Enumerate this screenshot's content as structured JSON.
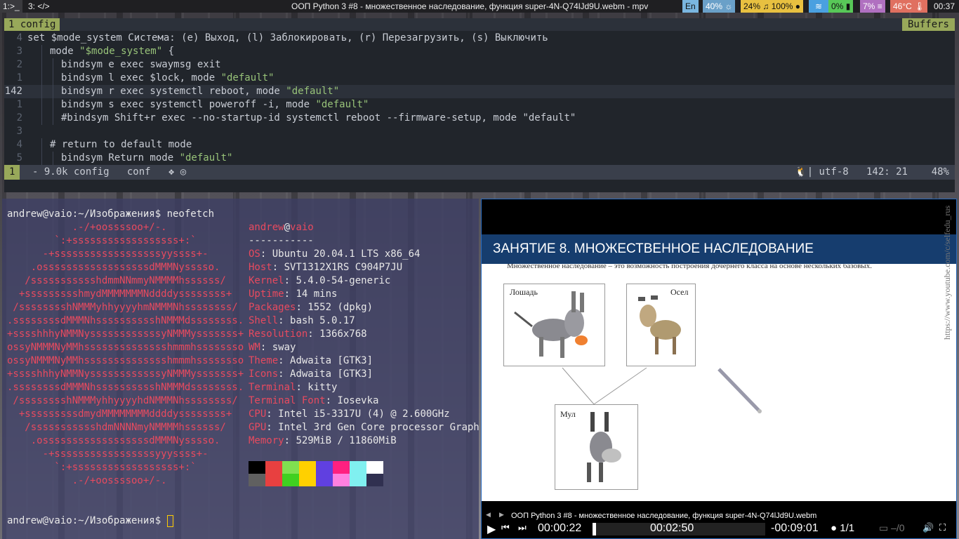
{
  "bar": {
    "ws1": "1:>_",
    "ws2": "3: </>",
    "title": "ООП Python 3 #8 - множественное наследование, функция super-4N-Q74lJd9U.webm - mpv",
    "lang": "En",
    "brightness": "40%",
    "volume": "24%",
    "mic": "100%",
    "battery": "0%",
    "cpu": "7%",
    "temp": "46°C",
    "clock": "00:37",
    "colors": {
      "lang": "#7ab6e0",
      "bright": "#6aa0c8",
      "vol": "#e8c040",
      "wifi": "#4aa0e0",
      "bat": "#58c858",
      "cpu": "#b070c0",
      "temp": "#e07060",
      "clock": "#1f1f22"
    }
  },
  "vim": {
    "tab_label": "1 config",
    "buffers_label": "Buffers",
    "lines": [
      {
        "num": "4",
        "text": "set $mode_system Система: (e) Выход, (l) Заблокировать, (r) Перезагрузить, (s) Выключить",
        "indent": 0,
        "cur": false
      },
      {
        "num": "3",
        "text": "mode \"$mode_system\" {",
        "indent": 2,
        "cur": false
      },
      {
        "num": "2",
        "text": "bindsym e exec swaymsg exit",
        "indent": 3,
        "cur": false
      },
      {
        "num": "1",
        "text": "bindsym l exec $lock, mode \"default\"",
        "indent": 3,
        "cur": false
      },
      {
        "num": "142",
        "text": "bindsym r exec systemctl reboot, mode \"default\"",
        "indent": 3,
        "cur": true
      },
      {
        "num": "1",
        "text": "bindsym s exec systemctl poweroff -i, mode \"default\"",
        "indent": 3,
        "cur": false
      },
      {
        "num": "2",
        "text": "#bindsym Shift+r exec --no-startup-id systemctl reboot --firmware-setup, mode \"default\"",
        "indent": 3,
        "cur": false
      },
      {
        "num": "3",
        "text": "",
        "indent": 0,
        "cur": false
      },
      {
        "num": "4",
        "text": "# return to default mode",
        "indent": 2,
        "cur": false
      },
      {
        "num": "5",
        "text": "bindsym Return mode \"default\"",
        "indent": 3,
        "cur": false
      }
    ],
    "status": {
      "mode": "1",
      "left": "- 9.0k config   conf   ❖ ◎",
      "right": "🐧| utf-8   142: 21    48%"
    }
  },
  "term": {
    "prompt1": "andrew@vaio:~/Изображения$ neofetch",
    "prompt2": "andrew@vaio:~/Изображения$ ",
    "logo": [
      "           .-/+oossssoo+/-.",
      "        `:+ssssssssssssssssss+:`",
      "      -+ssssssssssssssssssyyssss+-",
      "    .ossssssssssssssssssdMMMNysssso.",
      "   /ssssssssssshdmmNNmmyNMMMMhssssss/",
      "  +ssssssssshmydMMMMMMMNddddyssssssss+",
      " /sssssssshNMMMyhhyyyyhmNMMMNhssssssss/",
      ".ssssssssdMMMNhsssssssssshNMMMdssssssss.",
      "+sssshhhyNMMNyssssssssssssyNMMMysssssss+",
      "ossyNMMMNyMMhsssssssssssssshmmmhssssssso",
      "ossyNMMMNyMMhsssssssssssssshmmmhssssssso",
      "+sssshhhyNMMNyssssssssssssyNMMMysssssss+",
      ".ssssssssdMMMNhsssssssssshNMMMdssssssss.",
      " /sssssssshNMMMyhhyyyyhdNMMMNhssssssss/",
      "  +sssssssssdmydMMMMMMMMddddyssssssss+",
      "   /ssssssssssshdmNNNNmyNMMMMhssssss/",
      "    .ossssssssssssssssssdMMMNysssso.",
      "      -+sssssssssssssssssyyyssss+-",
      "        `:+ssssssssssssssssss+:`",
      "           .-/+oossssoo+/-."
    ],
    "user": "andrew",
    "at": "@",
    "host": "vaio",
    "sep": "-----------",
    "info": [
      {
        "k": "OS",
        "v": "Ubuntu 20.04.1 LTS x86_64"
      },
      {
        "k": "Host",
        "v": "SVT1312X1RS C904P7JU"
      },
      {
        "k": "Kernel",
        "v": "5.4.0-54-generic"
      },
      {
        "k": "Uptime",
        "v": "14 mins"
      },
      {
        "k": "Packages",
        "v": "1552 (dpkg)"
      },
      {
        "k": "Shell",
        "v": "bash 5.0.17"
      },
      {
        "k": "Resolution",
        "v": "1366x768"
      },
      {
        "k": "WM",
        "v": "sway"
      },
      {
        "k": "Theme",
        "v": "Adwaita [GTK3]"
      },
      {
        "k": "Icons",
        "v": "Adwaita [GTK3]"
      },
      {
        "k": "Terminal",
        "v": "kitty"
      },
      {
        "k": "Terminal Font",
        "v": "Iosevka"
      },
      {
        "k": "CPU",
        "v": "Intel i5-3317U (4) @ 2.600GHz"
      },
      {
        "k": "GPU",
        "v": "Intel 3rd Gen Core processor Graph"
      },
      {
        "k": "Memory",
        "v": "529MiB / 11860MiB"
      }
    ],
    "palette_top": [
      "#000000",
      "#e84040",
      "#80e050",
      "#ffd000",
      "#6040e0",
      "#ff2080",
      "#80f0f0",
      "#ffffff"
    ],
    "palette_bottom": [
      "#606060",
      "#e84040",
      "#40d020",
      "#ffd000",
      "#6040e0",
      "#ff80e0",
      "#80f0f0",
      "#303050"
    ]
  },
  "mpv": {
    "slide_title": "ЗАНЯТИЕ 8. МНОЖЕСТВЕННОЕ НАСЛЕДОВАНИЕ",
    "slide_sub": "Множественное наследование – это возможность построения дочернего класса на основе нескольких базовых.",
    "pic1": "Лошадь",
    "pic2": "Осел",
    "pic3": "Мул",
    "watermark": "https://www.youtube.com/c/selfedu_rus",
    "osc_title": "ООП Python 3 #8 - множественное наследование, функция super-4N-Q74lJd9U.webm",
    "time_pos": "00:00:22",
    "duration": "00:02:50",
    "remaining": "-00:09:01",
    "playlist": "1/1",
    "subs": "–/0",
    "progress": 0.02
  }
}
